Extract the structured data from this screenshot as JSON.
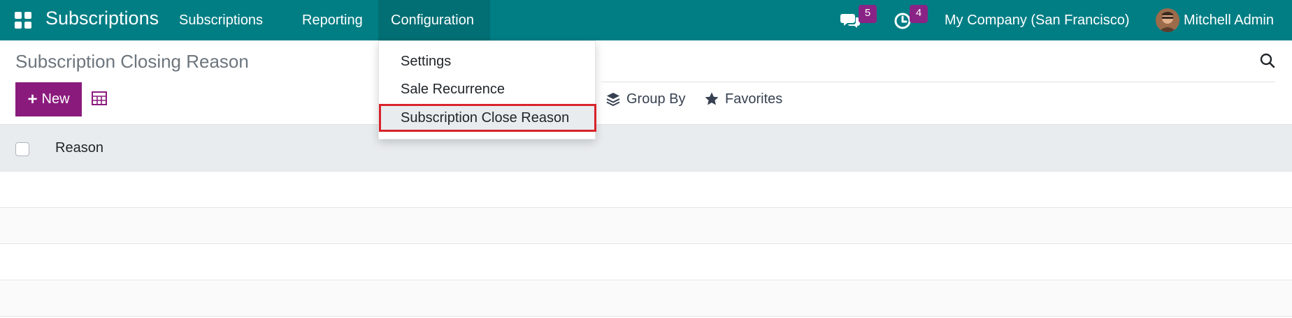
{
  "navbar": {
    "app_name": "Subscriptions",
    "menus": [
      "Subscriptions",
      "Reporting",
      "Configuration"
    ],
    "messages_count": "5",
    "activities_count": "4",
    "company": "My Company (San Francisco)",
    "user": "Mitchell Admin",
    "colors": {
      "bar": "#017e84",
      "badge": "#8a2386"
    }
  },
  "control_panel": {
    "title": "Subscription Closing Reason",
    "new_label": "New",
    "group_by_label": "Group By",
    "favorites_label": "Favorites"
  },
  "dropdown": {
    "items": [
      "Settings",
      "Sale Recurrence",
      "Subscription Close Reason"
    ],
    "highlighted": "Subscription Close Reason"
  },
  "list": {
    "columns": [
      "Reason"
    ],
    "rows": []
  }
}
